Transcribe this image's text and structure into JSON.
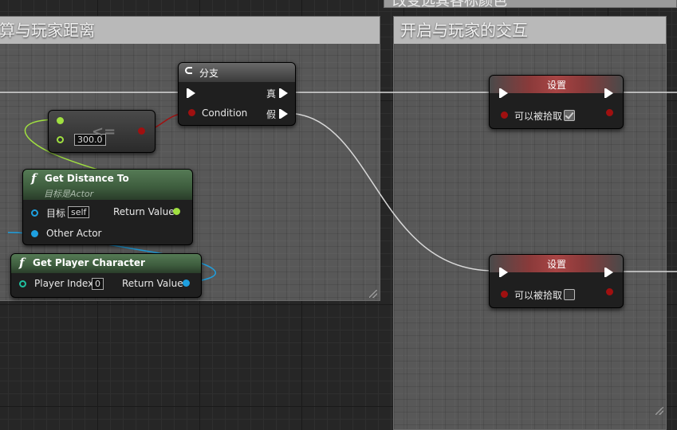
{
  "comments": {
    "left_title": "算与玩家距离",
    "right_title": "开启与玩家的交互",
    "top_cut_title": "改变选其各标颜色"
  },
  "branch": {
    "title": "分支",
    "condition_label": "Condition",
    "true_label": "真",
    "false_label": "假"
  },
  "compare": {
    "operator": "<=",
    "value": "300.0"
  },
  "get_distance": {
    "title": "Get Distance To",
    "subtitle": "目标是Actor",
    "target_label": "目标",
    "target_value": "self",
    "return_label": "Return Value",
    "other_label": "Other Actor"
  },
  "get_player": {
    "title": "Get Player Character",
    "index_label": "Player Index",
    "index_value": "0",
    "return_label": "Return Value"
  },
  "set_top": {
    "title": "设置",
    "prop_label": "可以被拾取",
    "checked": true
  },
  "set_bottom": {
    "title": "设置",
    "prop_label": "可以被拾取",
    "checked": false
  },
  "colors": {
    "exec": "#ffffff",
    "bool_pin": "#8c0000",
    "float_pin": "#a0e040",
    "object_pin": "#1ea0e0",
    "comment_bg": "#8c8c8c"
  }
}
